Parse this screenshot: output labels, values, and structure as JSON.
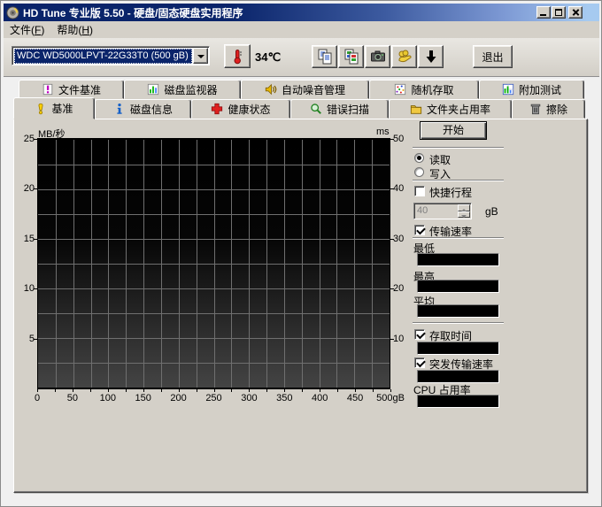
{
  "window": {
    "title": "HD Tune 专业版 5.50 - 硬盘/固态硬盘实用程序"
  },
  "menu": {
    "file": {
      "pre": "文件(",
      "key": "F",
      "suf": ")"
    },
    "help": {
      "pre": "帮助(",
      "key": "H",
      "suf": ")"
    }
  },
  "toolbar": {
    "drive_selector": {
      "value": "WDC WD5000LPVT-22G33T0 (500 gB)"
    },
    "temperature": "34℃",
    "thermometer_icon": "thermometer-icon",
    "buttons": [
      {
        "id": "copy-text",
        "icon": "copy-document-icon"
      },
      {
        "id": "copy-image",
        "icon": "copy-image-icon"
      },
      {
        "id": "screenshot",
        "icon": "camera-icon"
      },
      {
        "id": "donate",
        "icon": "donate-hand-icon"
      },
      {
        "id": "save",
        "icon": "down-arrow-icon"
      }
    ],
    "exit_label": "退出"
  },
  "tabs": {
    "row1": [
      {
        "id": "file-benchmark",
        "label": "文件基准",
        "icon": "file-benchmark-icon"
      },
      {
        "id": "disk-monitor",
        "label": "磁盘监视器",
        "icon": "disk-monitor-icon"
      },
      {
        "id": "aam",
        "label": "自动噪音管理",
        "icon": "speaker-icon"
      },
      {
        "id": "random-access",
        "label": "随机存取",
        "icon": "random-access-icon"
      },
      {
        "id": "extra-tests",
        "label": "附加测试",
        "icon": "extra-tests-icon"
      }
    ],
    "row2": [
      {
        "id": "benchmark",
        "label": "基准",
        "icon": "exclamation-icon",
        "active": true
      },
      {
        "id": "disk-info",
        "label": "磁盘信息",
        "icon": "info-icon"
      },
      {
        "id": "health",
        "label": "健康状态",
        "icon": "health-cross-icon"
      },
      {
        "id": "error-scan",
        "label": "错误扫描",
        "icon": "magnifier-icon"
      },
      {
        "id": "folder-usage",
        "label": "文件夹占用率",
        "icon": "folder-icon"
      },
      {
        "id": "erase",
        "label": "擦除",
        "icon": "trash-icon"
      }
    ]
  },
  "chart_data": {
    "type": "line",
    "title": "",
    "series": [],
    "left_axis": {
      "label": "MB/秒",
      "ticks": [
        25,
        20,
        15,
        10,
        5
      ],
      "range": [
        0,
        25
      ]
    },
    "right_axis": {
      "label": "ms",
      "ticks": [
        50,
        40,
        30,
        20,
        10
      ],
      "range": [
        0,
        50
      ]
    },
    "x_axis": {
      "ticks": [
        "0",
        "50",
        "100",
        "150",
        "200",
        "250",
        "300",
        "350",
        "400",
        "450",
        "500gB"
      ],
      "range": [
        0,
        500
      ]
    },
    "grid": true,
    "background": "black-gradient"
  },
  "panel": {
    "start_label": "开始",
    "mode": {
      "read_label": "读取",
      "write_label": "写入",
      "selected": "读取"
    },
    "short_stroke": {
      "label": "快捷行程",
      "checked": false,
      "value": "40",
      "unit": "gB"
    },
    "transfer_rate": {
      "label": "传输速率",
      "checked": true,
      "fields": [
        {
          "label": "最低",
          "value": ""
        },
        {
          "label": "最高",
          "value": ""
        },
        {
          "label": "平均",
          "value": ""
        }
      ]
    },
    "access_time": {
      "label": "存取时间",
      "checked": true,
      "value": ""
    },
    "burst_rate": {
      "label": "突发传输速率",
      "checked": true,
      "value": ""
    },
    "cpu_usage": {
      "label": "CPU 占用率",
      "value": ""
    }
  }
}
